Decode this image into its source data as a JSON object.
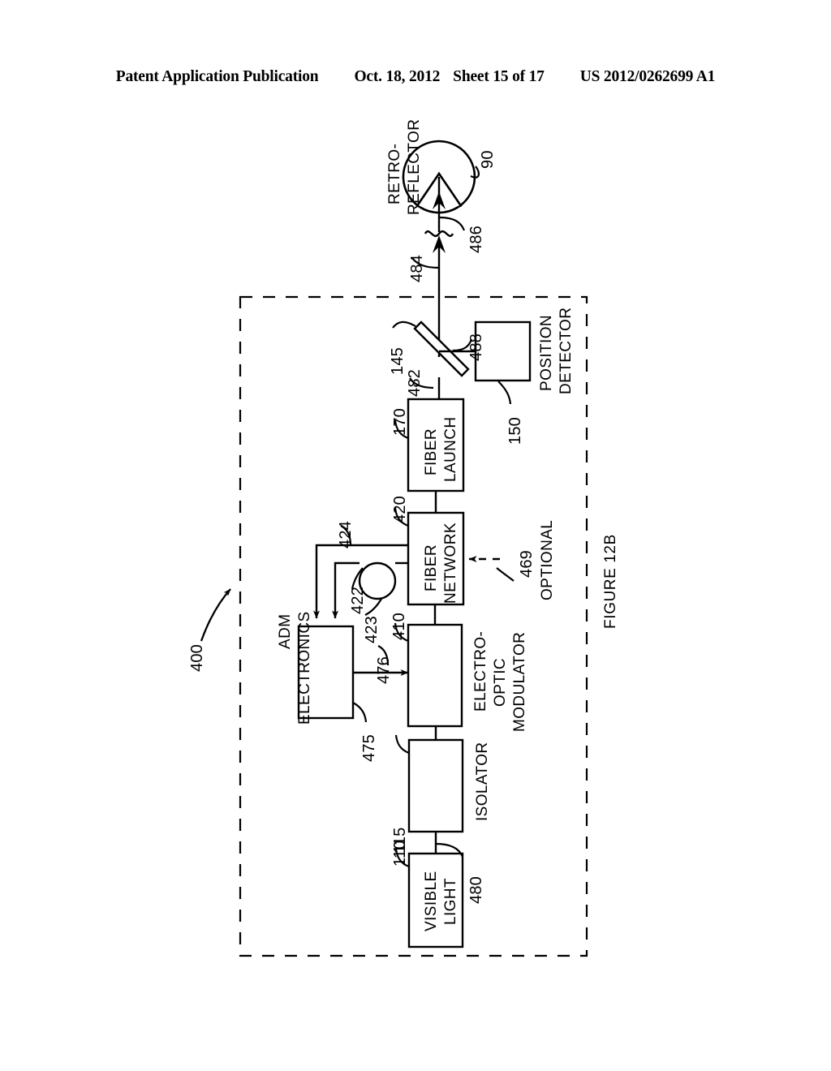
{
  "header": {
    "title": "Patent Application Publication",
    "date": "Oct. 18, 2012",
    "sheet": "Sheet 15 of 17",
    "publication_number": "US 2012/0262699 A1"
  },
  "figure": {
    "caption": "FIGURE 12B",
    "system_reference": "400",
    "optional_label": "OPTIONAL",
    "boundary": "dashed enclosure"
  },
  "blocks": [
    {
      "id": "retroreflector",
      "label": "RETRO-\nREFLECTOR",
      "label_line1": "RETRO-",
      "label_line2": "REFLECTOR",
      "ref": "90",
      "shape": "circle-with-notch"
    },
    {
      "id": "beamsplitter",
      "label": "",
      "ref": "145",
      "shape": "tilted-plate"
    },
    {
      "id": "position-detector",
      "label_line1": "POSITION",
      "label_line2": "DETECTOR",
      "ref": "150",
      "shape": "rect"
    },
    {
      "id": "fiber-launch",
      "label_line1": "FIBER",
      "label_line2": "LAUNCH",
      "ref": "170",
      "shape": "rect"
    },
    {
      "id": "fiber-network",
      "label_line1": "FIBER",
      "label_line2": "NETWORK",
      "ref": "420",
      "shape": "rect"
    },
    {
      "id": "adm-electronics",
      "label_line1": "ADM",
      "label_line2": "ELECTRONICS",
      "ref": "475",
      "shape": "rect"
    },
    {
      "id": "electro-optic-modulator",
      "label_line1": "ELECTRO-",
      "label_line2": "OPTIC",
      "label_line3": "MODULATOR",
      "ref": "410",
      "shape": "rect"
    },
    {
      "id": "isolator",
      "label_line1": "ISOLATOR",
      "ref": "115",
      "shape": "rect"
    },
    {
      "id": "visible-light",
      "label_line1": "VISIBLE",
      "label_line2": "LIGHT",
      "ref": "110",
      "shape": "rect"
    }
  ],
  "reference_numerals": {
    "system": "400",
    "retroreflector": "90",
    "visible_light": "110",
    "isolator": "115",
    "beamsplitter": "145",
    "position_detector": "150",
    "fiber_launch": "170",
    "electro_optic_modulator": "410",
    "fiber_network": "420",
    "fiber_line_422": "422",
    "fiber_loop_423": "423",
    "fiber_line_424": "424",
    "optional_input_469": "469",
    "adm_electronics": "475",
    "modulator_drive_476": "476",
    "light_source_output_480": "480",
    "launch_beam_482": "482",
    "outgoing_beam_484": "484",
    "returning_beam_486": "486",
    "detector_beam_488": "488"
  }
}
